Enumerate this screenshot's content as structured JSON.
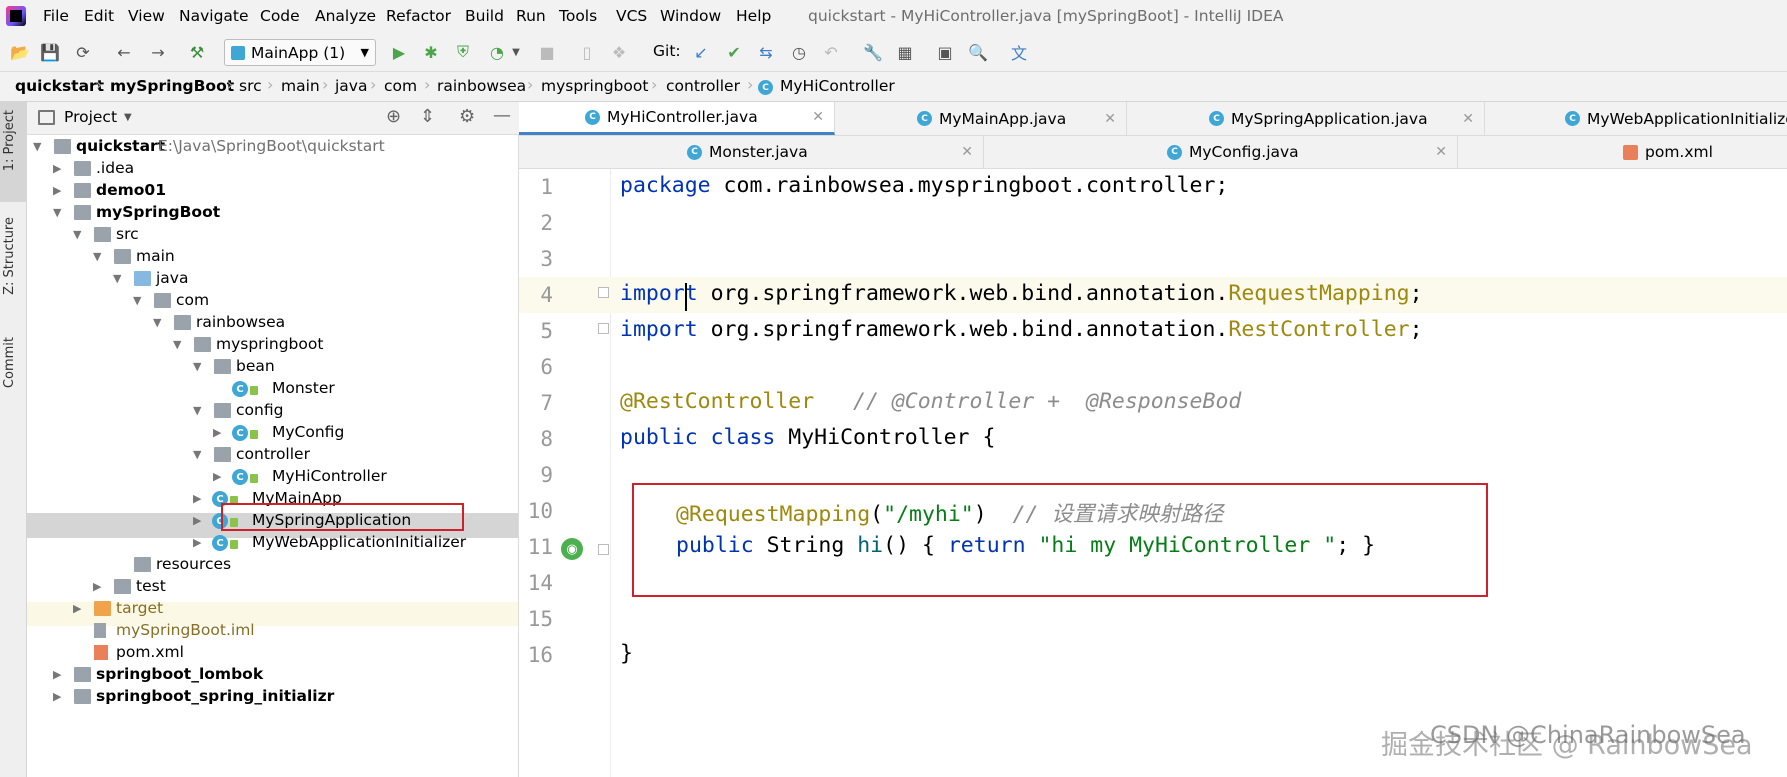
{
  "window_title": "quickstart - MyHiController.java [mySpringBoot] - IntelliJ IDEA",
  "menu": [
    "File",
    "Edit",
    "View",
    "Navigate",
    "Code",
    "Analyze",
    "Refactor",
    "Build",
    "Run",
    "Tools",
    "VCS",
    "Window",
    "Help"
  ],
  "toolbar": {
    "run_config": "MainApp (1)",
    "git_label": "Git:"
  },
  "breadcrumb": [
    "quickstart",
    "mySpringBoot",
    "src",
    "main",
    "java",
    "com",
    "rainbowsea",
    "myspringboot",
    "controller",
    "MyHiController"
  ],
  "left_strip": {
    "project": "1: Project",
    "structure": "Z: Structure",
    "commit": "Commit"
  },
  "project_panel": {
    "title": "Project"
  },
  "tree": [
    {
      "label": "quickstart",
      "extra": "E:\\Java\\SpringBoot\\quickstart",
      "bold": true
    },
    {
      "label": ".idea"
    },
    {
      "label": "demo01",
      "bold": true
    },
    {
      "label": "mySpringBoot",
      "bold": true
    },
    {
      "label": "src"
    },
    {
      "label": "main"
    },
    {
      "label": "java"
    },
    {
      "label": "com"
    },
    {
      "label": "rainbowsea"
    },
    {
      "label": "myspringboot"
    },
    {
      "label": "bean"
    },
    {
      "label": "Monster"
    },
    {
      "label": "config"
    },
    {
      "label": "MyConfig"
    },
    {
      "label": "controller"
    },
    {
      "label": "MyHiController"
    },
    {
      "label": "MyMainApp"
    },
    {
      "label": "MySpringApplication"
    },
    {
      "label": "MyWebApplicationInitializer"
    },
    {
      "label": "resources"
    },
    {
      "label": "test"
    },
    {
      "label": "target"
    },
    {
      "label": "mySpringBoot.iml"
    },
    {
      "label": "pom.xml"
    },
    {
      "label": "springboot_lombok",
      "bold": true
    },
    {
      "label": "springboot_spring_initializr",
      "bold": true
    }
  ],
  "tabs_row1": [
    "MyHiController.java",
    "MyMainApp.java",
    "MySpringApplication.java",
    "MyWebApplicationInitializer.j"
  ],
  "tabs_row2": [
    "Monster.java",
    "MyConfig.java",
    "pom.xml"
  ],
  "line_numbers": [
    "1",
    "2",
    "3",
    "4",
    "5",
    "6",
    "7",
    "8",
    "9",
    "10",
    "11",
    "14",
    "15",
    "16"
  ],
  "code": {
    "l1_kw": "package",
    "l1_rest": " com.rainbowsea.myspringboot.controller;",
    "l4_kw": "import",
    "l4_pkg": " org.springframework.web.bind.annotation.",
    "l4_cls": "RequestMapping",
    "l4_end": ";",
    "l5_kw": "import",
    "l5_pkg": " org.springframework.web.bind.annotation.",
    "l5_cls": "RestController",
    "l5_end": ";",
    "l7_ann": "@RestController",
    "l7_cmt": "   // @Controller +  @ResponseBod",
    "l8_kw": "public class",
    "l8_rest": " MyHiController {",
    "l10_ann": "@RequestMapping",
    "l10_open": "(",
    "l10_str": "\"/myhi\"",
    "l10_close": ")",
    "l10_cmt": "  // 设置请求映射路径",
    "l11_kw": "public",
    "l11_type": " String ",
    "l11_mth": "hi",
    "l11_mid": "() { ",
    "l11_ret": "return",
    "l11_str": " \"hi my MyHiController \"",
    "l11_end": "; }",
    "l15": "}"
  },
  "watermark": "掘金技术社区 @ RainbowSea",
  "watermark2": "CSDN @ChinaRainbowSea"
}
